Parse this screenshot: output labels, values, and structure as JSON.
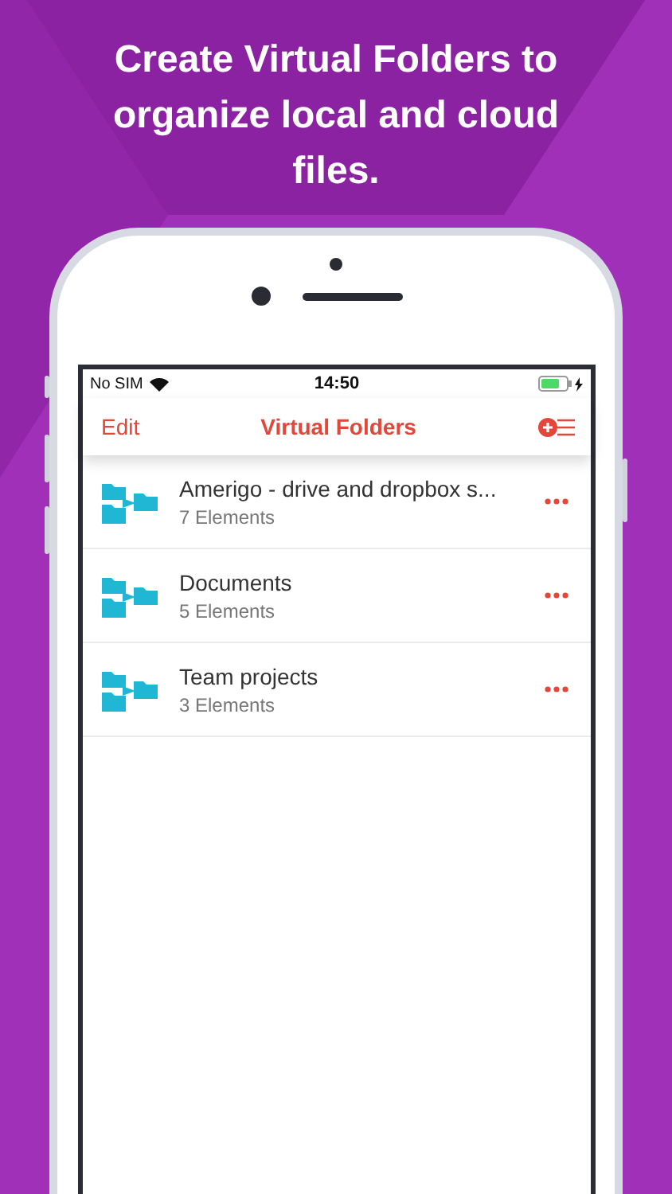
{
  "headline": "Create Virtual Folders to organize local and cloud files.",
  "status_bar": {
    "carrier": "No SIM",
    "time": "14:50",
    "charging": true
  },
  "nav_bar": {
    "left": "Edit",
    "title": "Virtual Folders"
  },
  "folders": [
    {
      "name": "Amerigo - drive and dropbox s...",
      "count": "7 Elements"
    },
    {
      "name": "Documents",
      "count": "5 Elements"
    },
    {
      "name": "Team projects",
      "count": "3 Elements"
    }
  ]
}
